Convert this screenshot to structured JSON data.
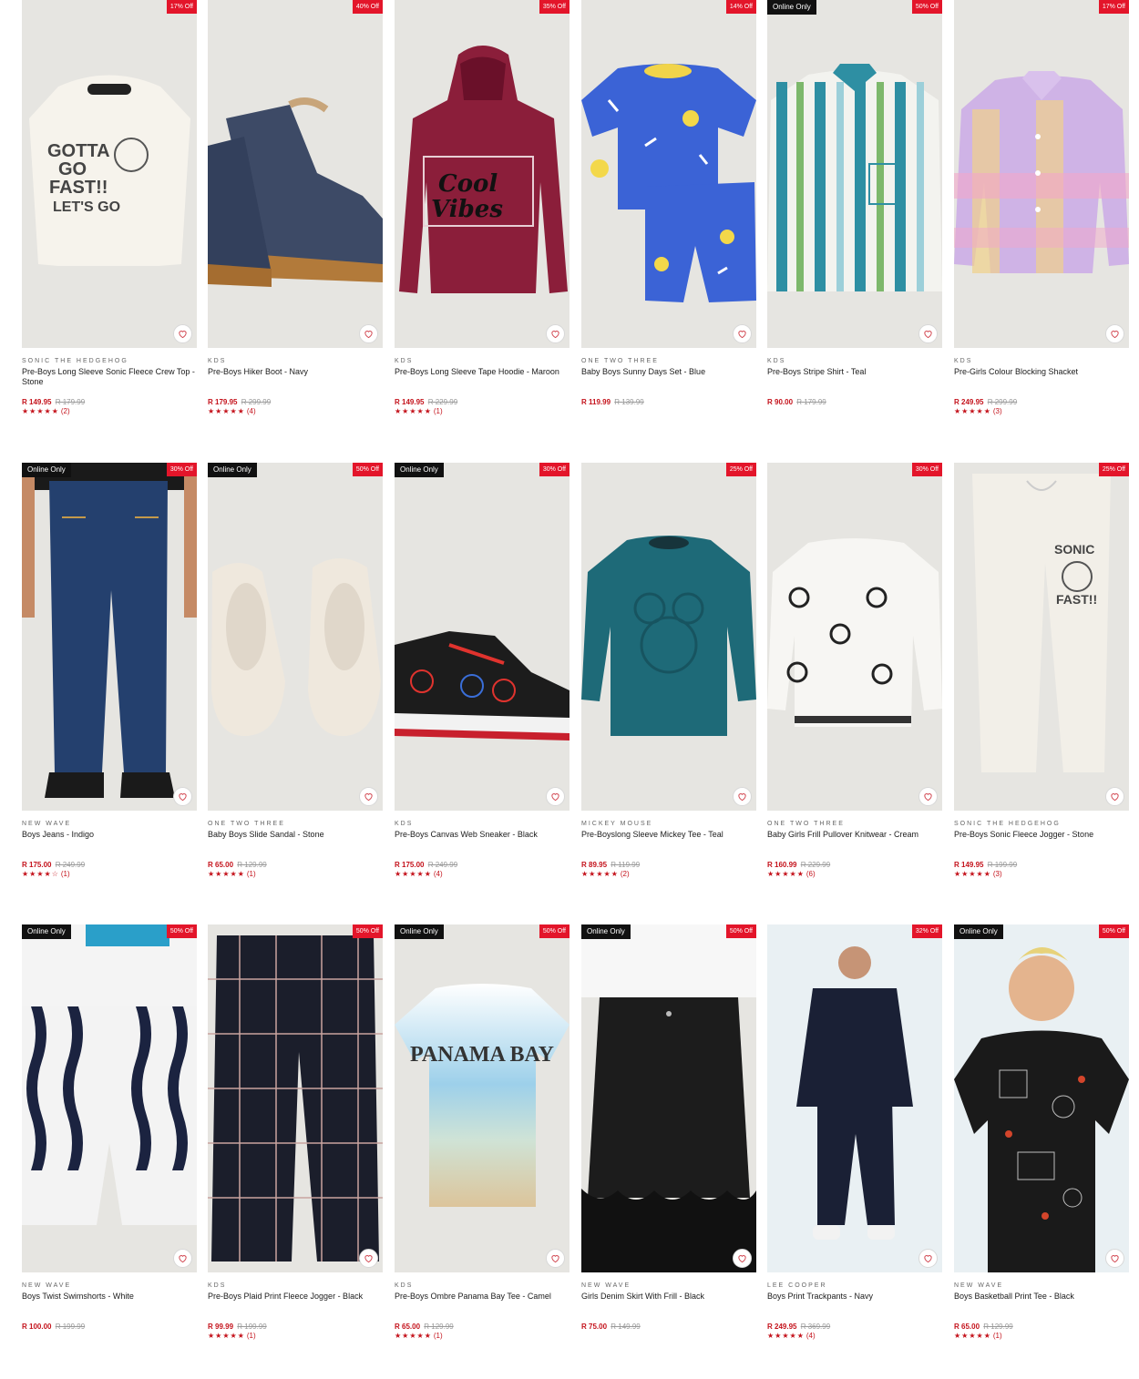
{
  "colors": {
    "sale": "#e3152a",
    "price": "#c4121b",
    "online_badge": "#111111",
    "image_bg": "#e5e5e3"
  },
  "products": [
    {
      "brand": "SONIC THE HEDGEHOG",
      "name": "Pre-Boys Long Sleeve Sonic Fleece Crew Top - Stone",
      "price": "R 149.95",
      "was": "R 179.99",
      "discount": "17% Off",
      "online": false,
      "rating_value": 5,
      "stars": "★★★★★",
      "reviews": "(2)",
      "art": "sonic-sweatshirt"
    },
    {
      "brand": "KDS",
      "name": "Pre-Boys Hiker Boot - Navy",
      "price": "R 179.95",
      "was": "R 299.99",
      "discount": "40% Off",
      "online": false,
      "rating_value": 5,
      "stars": "★★★★★",
      "reviews": "(4)",
      "art": "boot"
    },
    {
      "brand": "KDS",
      "name": "Pre-Boys Long Sleeve Tape Hoodie - Maroon",
      "price": "R 149.95",
      "was": "R 229.99",
      "discount": "35% Off",
      "online": false,
      "rating_value": 5,
      "stars": "★★★★★",
      "reviews": "(1)",
      "art": "hoodie"
    },
    {
      "brand": "ONE TWO THREE",
      "name": "Baby Boys Sunny Days Set - Blue",
      "price": "R 119.99",
      "was": "R 139.99",
      "discount": "14% Off",
      "online": false,
      "rating_value": null,
      "stars": "",
      "reviews": "",
      "art": "blue-set"
    },
    {
      "brand": "KDS",
      "name": "Pre-Boys Stripe Shirt - Teal",
      "price": "R 90.00",
      "was": "R 179.99",
      "discount": "50% Off",
      "online": true,
      "online_label": "Online Only",
      "rating_value": null,
      "stars": "",
      "reviews": "",
      "art": "stripe-shirt"
    },
    {
      "brand": "KDS",
      "name": "Pre-Girls Colour Blocking Shacket",
      "price": "R 249.95",
      "was": "R 299.99",
      "discount": "17% Off",
      "online": false,
      "rating_value": 5,
      "stars": "★★★★★",
      "reviews": "(3)",
      "art": "shacket"
    },
    {
      "brand": "NEW WAVE",
      "name": "Boys Jeans - Indigo",
      "price": "R 175.00",
      "was": "R 249.99",
      "discount": "30% Off",
      "online": true,
      "online_label": "Online Only",
      "rating_value": 4,
      "stars": "★★★★☆",
      "reviews": "(1)",
      "art": "jeans"
    },
    {
      "brand": "ONE TWO THREE",
      "name": "Baby Boys Slide Sandal - Stone",
      "price": "R 65.00",
      "was": "R 129.99",
      "discount": "50% Off",
      "online": true,
      "online_label": "Online Only",
      "rating_value": 5,
      "stars": "★★★★★",
      "reviews": "(1)",
      "art": "slides"
    },
    {
      "brand": "KDS",
      "name": "Pre-Boys Canvas Web Sneaker - Black",
      "price": "R 175.00",
      "was": "R 249.99",
      "discount": "30% Off",
      "online": true,
      "online_label": "Online Only",
      "rating_value": 5,
      "stars": "★★★★★",
      "reviews": "(4)",
      "art": "sneaker"
    },
    {
      "brand": "MICKEY MOUSE",
      "name": "Pre-Boyslong Sleeve Mickey Tee - Teal",
      "price": "R 89.95",
      "was": "R 119.99",
      "discount": "25% Off",
      "online": false,
      "rating_value": 5,
      "stars": "★★★★★",
      "reviews": "(2)",
      "art": "mickey-tee"
    },
    {
      "brand": "ONE TWO THREE",
      "name": "Baby Girls Frill Pullover Knitwear - Cream",
      "price": "R 160.99",
      "was": "R 229.99",
      "discount": "30% Off",
      "online": false,
      "rating_value": 5,
      "stars": "★★★★★",
      "reviews": "(6)",
      "art": "knitwear"
    },
    {
      "brand": "SONIC THE HEDGEHOG",
      "name": "Pre-Boys Sonic Fleece Jogger - Stone",
      "price": "R 149.95",
      "was": "R 199.99",
      "discount": "25% Off",
      "online": false,
      "rating_value": 5,
      "stars": "★★★★★",
      "reviews": "(3)",
      "art": "jogger"
    },
    {
      "brand": "NEW WAVE",
      "name": "Boys Twist Swimshorts - White",
      "price": "R 100.00",
      "was": "R 199.99",
      "discount": "50% Off",
      "online": true,
      "online_label": "Online Only",
      "rating_value": null,
      "stars": "",
      "reviews": "",
      "art": "swimshorts"
    },
    {
      "brand": "KDS",
      "name": "Pre-Boys Plaid Print Fleece Jogger - Black",
      "price": "R 99.99",
      "was": "R 199.99",
      "discount": "50% Off",
      "online": false,
      "rating_value": 5,
      "stars": "★★★★★",
      "reviews": "(1)",
      "art": "plaid"
    },
    {
      "brand": "KDS",
      "name": "Pre-Boys Ombre Panama Bay Tee - Camel",
      "price": "R 65.00",
      "was": "R 129.99",
      "discount": "50% Off",
      "online": true,
      "online_label": "Online Only",
      "rating_value": 5,
      "stars": "★★★★★",
      "reviews": "(1)",
      "art": "panama-tee",
      "art_text": "PANAMA BAY"
    },
    {
      "brand": "NEW WAVE",
      "name": "Girls Denim Skirt With Frill - Black",
      "price": "R 75.00",
      "was": "R 149.99",
      "discount": "50% Off",
      "online": true,
      "online_label": "Online Only",
      "rating_value": null,
      "stars": "",
      "reviews": "",
      "art": "skirt"
    },
    {
      "brand": "LEE COOPER",
      "name": "Boys Print Trackpants - Navy",
      "price": "R 249.95",
      "was": "R 369.99",
      "discount": "32% Off",
      "online": false,
      "rating_value": 5,
      "stars": "★★★★★",
      "reviews": "(4)",
      "art": "trackpants"
    },
    {
      "brand": "NEW WAVE",
      "name": "Boys Basketball Print Tee - Black",
      "price": "R 65.00",
      "was": "R 129.99",
      "discount": "50% Off",
      "online": true,
      "online_label": "Online Only",
      "rating_value": 5,
      "stars": "★★★★★",
      "reviews": "(1)",
      "art": "basketball-tee"
    }
  ]
}
